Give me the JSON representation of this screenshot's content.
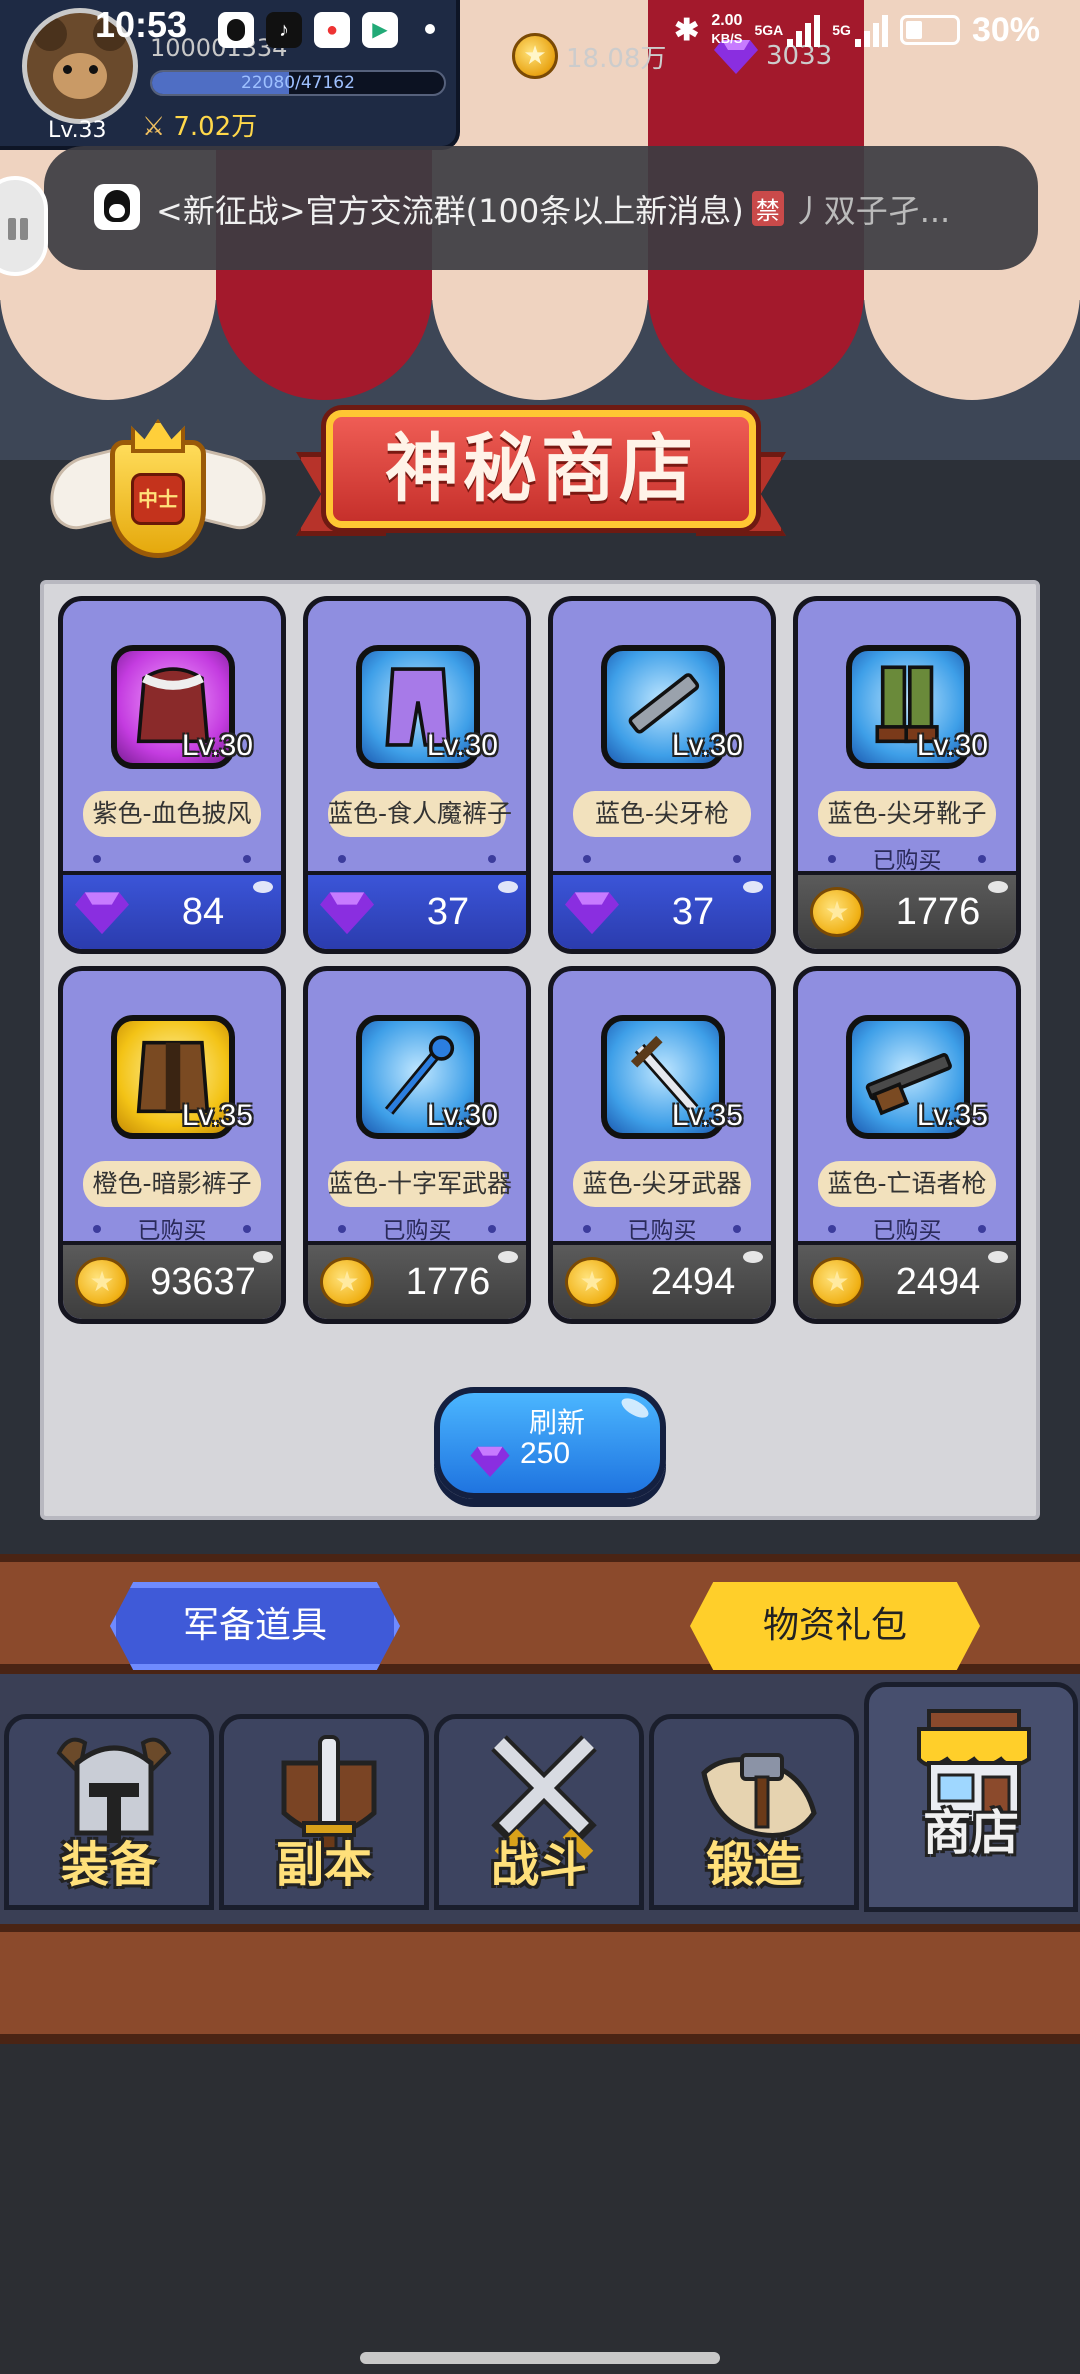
{
  "status_bar": {
    "time": "10:53",
    "speed": "2.00",
    "speed_unit": "KB/S",
    "network_1": "5GA",
    "network_2": "5G",
    "battery": "30%"
  },
  "player": {
    "id": "100001334",
    "level": "Lv.33",
    "exp": "22080/47162",
    "exp_fraction": 0.468,
    "power": "7.02万",
    "coins": "18.08万",
    "gems": "3033"
  },
  "notification": {
    "text": "<新征战>官方交流群(100条以上新消息)",
    "tag": "禁",
    "tail": "丿双子孑..."
  },
  "rank": {
    "badge": "中士"
  },
  "shop": {
    "title": "神秘商店",
    "items": [
      {
        "name": "紫色-血色披风",
        "level": "Lv.30",
        "currency": "gem",
        "price": "84",
        "bought": "",
        "rarity": "purple",
        "icon": "cape-icon"
      },
      {
        "name": "蓝色-食人魔裤子",
        "level": "Lv.30",
        "currency": "gem",
        "price": "37",
        "bought": "",
        "rarity": "blue",
        "icon": "pants-icon"
      },
      {
        "name": "蓝色-尖牙枪",
        "level": "Lv.30",
        "currency": "gem",
        "price": "37",
        "bought": "",
        "rarity": "blue",
        "icon": "gun-icon"
      },
      {
        "name": "蓝色-尖牙靴子",
        "level": "Lv.30",
        "currency": "coin",
        "price": "1776",
        "bought": "已购买",
        "rarity": "blue",
        "icon": "boots-icon"
      },
      {
        "name": "橙色-暗影裤子",
        "level": "Lv.35",
        "currency": "coin",
        "price": "93637",
        "bought": "已购买",
        "rarity": "orange",
        "icon": "armor-icon"
      },
      {
        "name": "蓝色-十字军武器",
        "level": "Lv.30",
        "currency": "coin",
        "price": "1776",
        "bought": "已购买",
        "rarity": "blue",
        "icon": "staff-icon"
      },
      {
        "name": "蓝色-尖牙武器",
        "level": "Lv.35",
        "currency": "coin",
        "price": "2494",
        "bought": "已购买",
        "rarity": "blue",
        "icon": "dagger-icon"
      },
      {
        "name": "蓝色-亡语者枪",
        "level": "Lv.35",
        "currency": "coin",
        "price": "2494",
        "bought": "已购买",
        "rarity": "blue",
        "icon": "rifle-icon"
      }
    ],
    "refresh": {
      "label": "刷新",
      "cost": "250"
    }
  },
  "categories": {
    "left": "军备道具",
    "right": "物资礼包"
  },
  "nav": [
    {
      "label": "装备",
      "icon": "helmet-icon"
    },
    {
      "label": "副本",
      "icon": "sword-shield-icon"
    },
    {
      "label": "战斗",
      "icon": "crossed-swords-icon"
    },
    {
      "label": "锻造",
      "icon": "hammer-scroll-icon"
    },
    {
      "label": "商店",
      "icon": "shop-icon",
      "active": true
    }
  ],
  "colors": {
    "accent_gold": "#ffcf2a",
    "accent_blue": "#3f5ad8",
    "card_bg": "#8f8ee0",
    "awning_red": "#a01f2f",
    "awning_cream": "#f0d6c2"
  }
}
